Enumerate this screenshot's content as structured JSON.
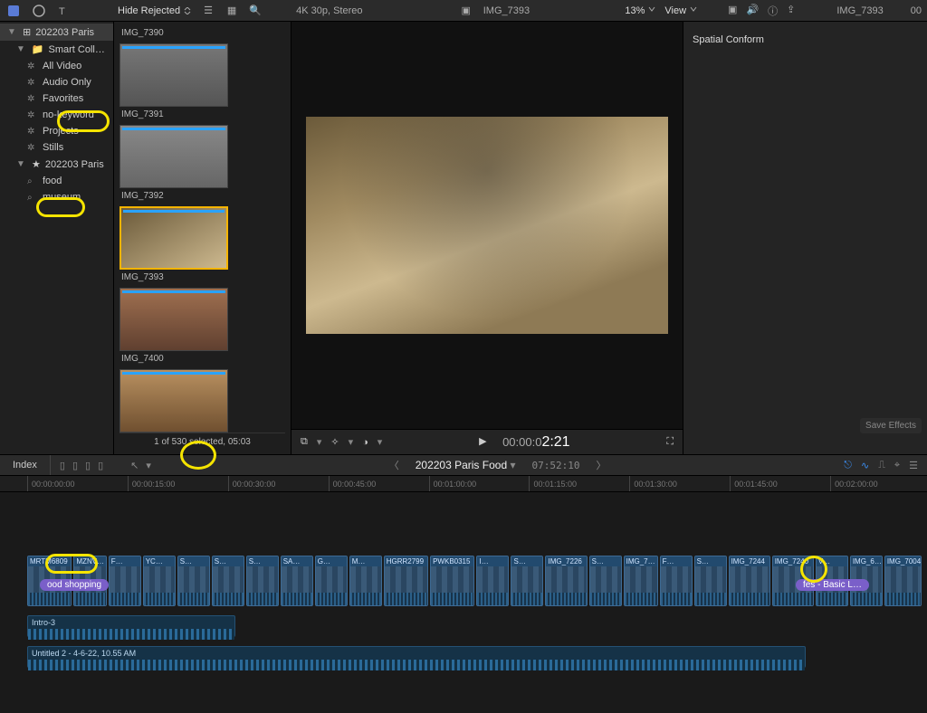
{
  "topbar": {
    "filter_label": "Hide Rejected",
    "format": "4K 30p, Stereo",
    "current_clip": "IMG_7393",
    "zoom": "13%",
    "view_label": "View"
  },
  "inspector": {
    "clip": "IMG_7393",
    "tc": "00",
    "section": "Spatial Conform",
    "save_effects": "Save Effects"
  },
  "sidebar": {
    "library": "202203 Paris",
    "smart_label": "Smart Colle…",
    "items": [
      {
        "label": "All Video"
      },
      {
        "label": "Audio Only"
      },
      {
        "label": "Favorites"
      },
      {
        "label": "no-keyword"
      },
      {
        "label": "Projects"
      },
      {
        "label": "Stills"
      }
    ],
    "event": "202203 Paris",
    "keywords": [
      {
        "label": "food"
      },
      {
        "label": "museum"
      }
    ]
  },
  "browser": {
    "clips": [
      {
        "label": "IMG_7390"
      },
      {
        "label": "IMG_7391"
      },
      {
        "label": "IMG_7392"
      },
      {
        "label": "IMG_7393",
        "selected": true
      },
      {
        "label": "IMG_7400"
      },
      {
        "label": ""
      }
    ],
    "status": "1 of 530 selected, 05:03"
  },
  "viewer": {
    "tc_prefix": "00:00:0",
    "tc_big": "2:21"
  },
  "tl_header": {
    "index": "Index",
    "title": "202203 Paris Food",
    "tc": "07:52:10"
  },
  "ruler": [
    "00:00:00:00",
    "00:00:15:00",
    "00:00:30:00",
    "00:00:45:00",
    "00:01:00:00",
    "00:01:15:00",
    "00:01:30:00",
    "00:01:45:00",
    "00:02:00:00"
  ],
  "chapters": {
    "left": "ood shopping",
    "right": "fes - Basic L…"
  },
  "clips": [
    "MRTM6809",
    "MZNV…",
    "F…",
    "YC…",
    "S…",
    "S…",
    "S…",
    "SA…",
    "G…",
    "M…",
    "HGRR2799",
    "PWKB0315",
    "I…",
    "S…",
    "IMG_7226",
    "S…",
    "IMG_7…",
    "F…",
    "S…",
    "IMG_7244",
    "IMG_7240",
    "V…",
    "IMG_6…",
    "IMG_7004"
  ],
  "audio": {
    "a1": "Intro-3",
    "a2": "Untitled 2 - 4-6-22, 10.55 AM"
  }
}
